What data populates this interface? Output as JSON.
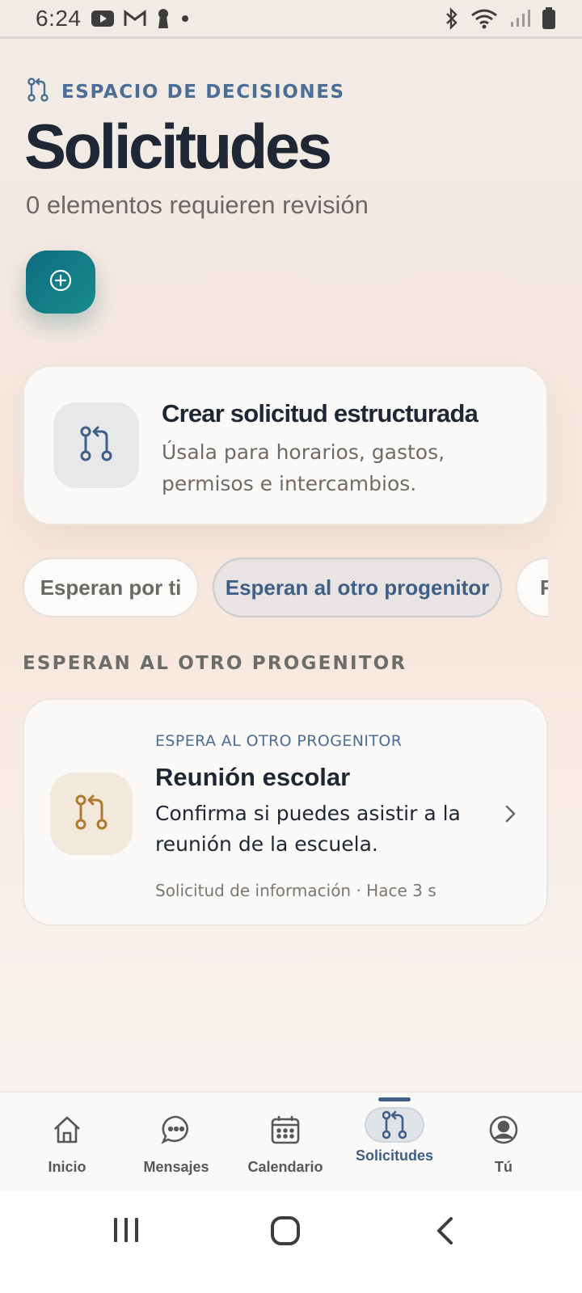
{
  "status_bar": {
    "time": "6:24",
    "left_icons": [
      "youtube-icon",
      "gmail-icon",
      "keyhole-icon",
      "dot-icon"
    ],
    "right_icons": [
      "bluetooth-icon",
      "wifi-icon",
      "signal-icon",
      "battery-icon"
    ]
  },
  "header": {
    "eyebrow": "ESPACIO DE DECISIONES",
    "title": "Solicitudes",
    "subtitle": "0 elementos requieren revisión"
  },
  "fab": {
    "icon": "plus-circle-icon",
    "accent": "#137a86"
  },
  "create_card": {
    "title": "Crear solicitud estructurada",
    "description": "Úsala para horarios, gastos, permisos e intercambios."
  },
  "filters": {
    "items": [
      {
        "label": "Esperan por ti",
        "active": false
      },
      {
        "label": "Esperan al otro progenitor",
        "active": true
      },
      {
        "label": "R",
        "active": false
      }
    ]
  },
  "section": {
    "label": "ESPERAN AL OTRO PROGENITOR"
  },
  "requests": [
    {
      "status": "ESPERA AL OTRO PROGENITOR",
      "title": "Reunión escolar",
      "description": "Confirma si puedes asistir a la reunión de la escuela.",
      "meta": "Solicitud de información · Hace 3 s"
    }
  ],
  "bottom_nav": {
    "items": [
      {
        "label": "Inicio",
        "icon": "home-icon"
      },
      {
        "label": "Mensajes",
        "icon": "chat-icon"
      },
      {
        "label": "Calendario",
        "icon": "calendar-icon"
      },
      {
        "label": "Solicitudes",
        "icon": "pull-request-icon",
        "active": true
      },
      {
        "label": "Tú",
        "icon": "user-icon"
      }
    ]
  },
  "colors": {
    "accent_blue": "#4b6e97",
    "title_dark": "#1e2733",
    "fab_teal": "#137a86",
    "request_icon_gold": "#b07a2e"
  }
}
